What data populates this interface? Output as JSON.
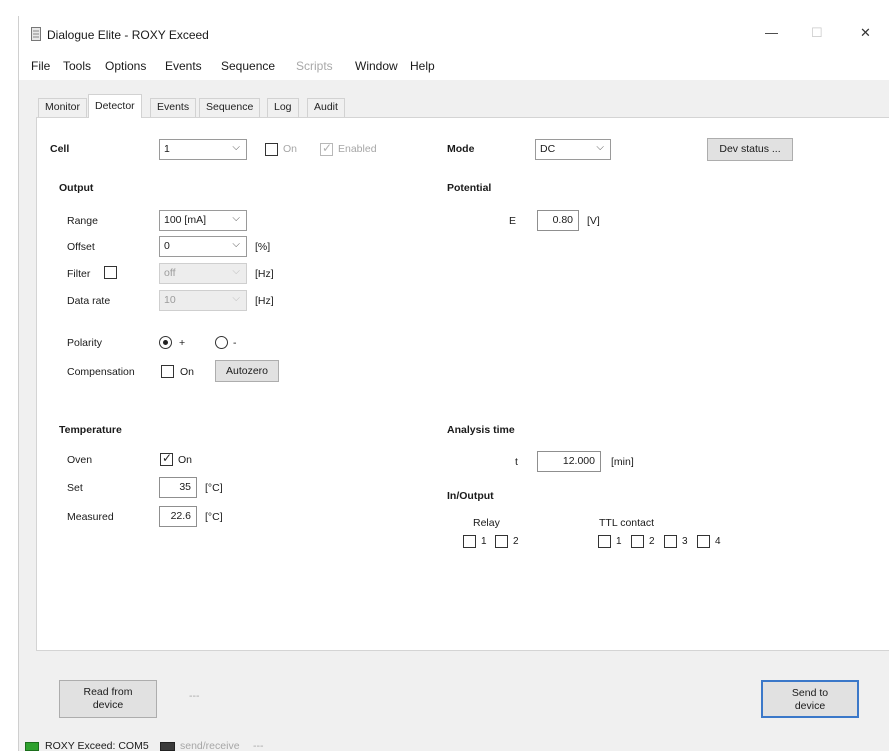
{
  "window": {
    "title": "Dialogue Elite - ROXY Exceed",
    "minimize": "—",
    "maximize": "☐",
    "close": "✕"
  },
  "menu": [
    "File",
    "Tools",
    "Options",
    "Events",
    "Sequence",
    "Scripts",
    "Window",
    "Help"
  ],
  "tabs": [
    "Monitor",
    "Detector",
    "Events",
    "Sequence",
    "Log",
    "Audit"
  ],
  "top_row": {
    "cell_label": "Cell",
    "cell_value": "1",
    "on_label": "On",
    "enabled_label": "Enabled",
    "mode_label": "Mode",
    "mode_value": "DC",
    "dev_status": "Dev status ..."
  },
  "output": {
    "heading": "Output",
    "range_label": "Range",
    "range_value": "100 [mA]",
    "offset_label": "Offset",
    "offset_value": "0",
    "offset_unit": "[%]",
    "filter_label": "Filter",
    "filter_value": "off",
    "filter_unit": "[Hz]",
    "data_rate_label": "Data rate",
    "data_rate_value": "10",
    "data_rate_unit": "[Hz]",
    "polarity_label": "Polarity",
    "polarity_plus": "+",
    "polarity_minus": "-",
    "compensation_label": "Compensation",
    "comp_on_label": "On",
    "autozero": "Autozero"
  },
  "potential": {
    "heading": "Potential",
    "e_label": "E",
    "e_value": "0.80",
    "e_unit": "[V]"
  },
  "temperature": {
    "heading": "Temperature",
    "oven_label": "Oven",
    "oven_on_label": "On",
    "set_label": "Set",
    "set_value": "35",
    "set_unit": "[°C]",
    "measured_label": "Measured",
    "measured_value": "22.6",
    "measured_unit": "[°C]"
  },
  "analysis": {
    "heading": "Analysis time",
    "t_label": "t",
    "t_value": "12.000",
    "t_unit": "[min]"
  },
  "inout": {
    "heading": "In/Output",
    "relay_label": "Relay",
    "relay_items": [
      "1",
      "2"
    ],
    "ttl_label": "TTL contact",
    "ttl_items": [
      "1",
      "2",
      "3",
      "4"
    ]
  },
  "bottom": {
    "read_line1": "Read from",
    "read_line2": "device",
    "send_line1": "Send to",
    "send_line2": "device",
    "separator": "---"
  },
  "status": {
    "connection": "ROXY Exceed: COM5",
    "activity": "send/receive",
    "tail": "---"
  }
}
